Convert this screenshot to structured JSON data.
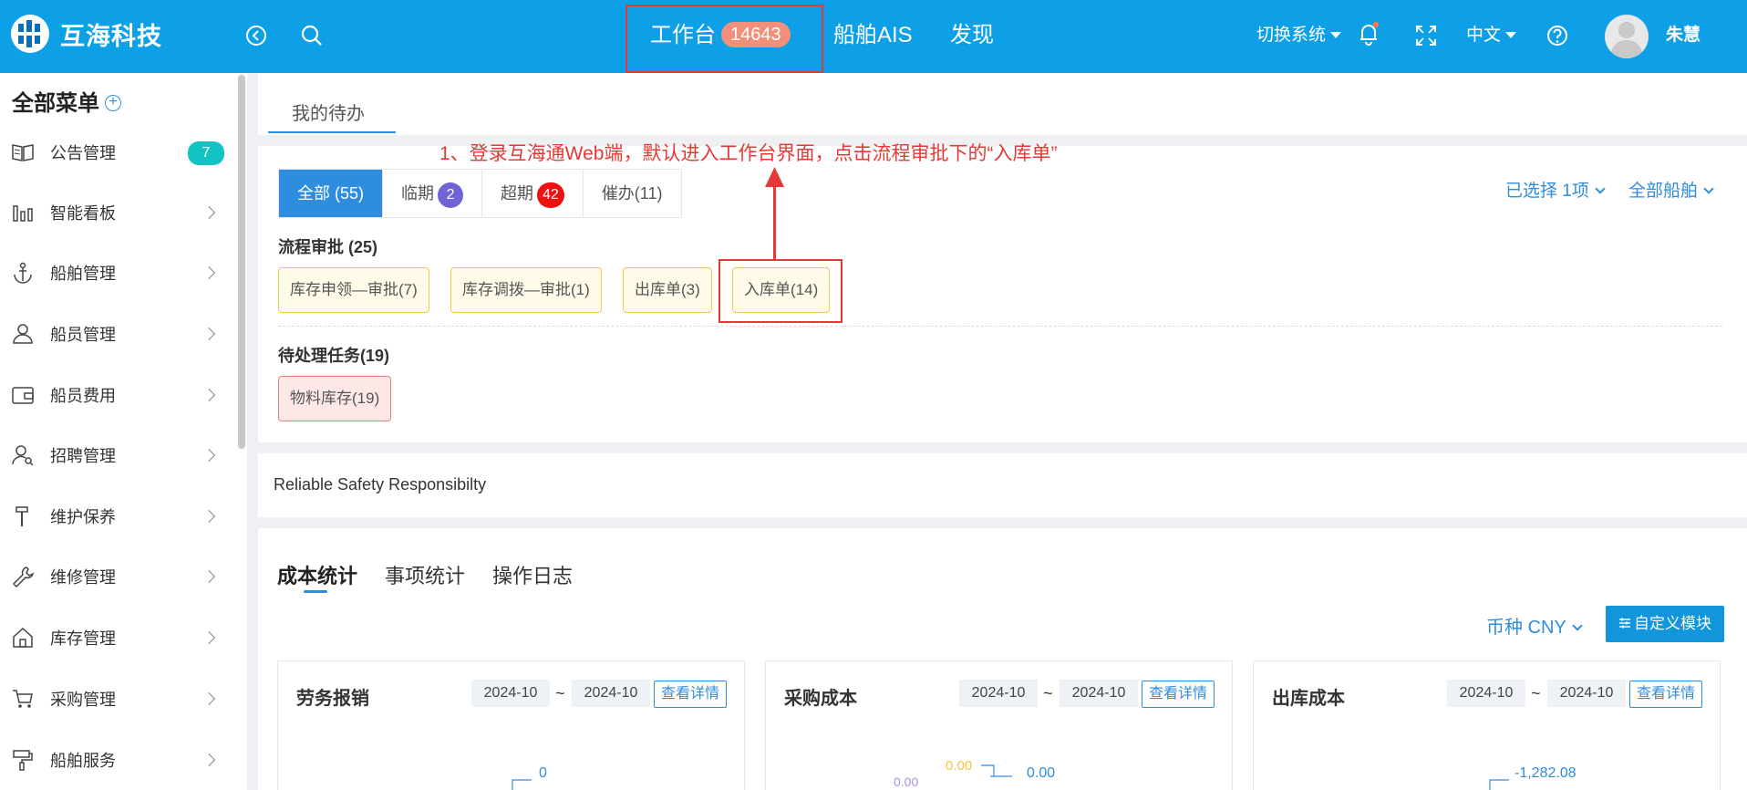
{
  "app": {
    "name": "互海科技"
  },
  "topnav": {
    "items": [
      {
        "label": "工作台",
        "badge": "14643"
      },
      {
        "label": "船舶AIS"
      },
      {
        "label": "发现"
      }
    ],
    "switch_system": "切换系统",
    "language": "中文",
    "username": "朱慧"
  },
  "sidebar": {
    "title": "全部菜单",
    "items": [
      {
        "label": "公告管理",
        "icon": "book-icon",
        "badge": "7"
      },
      {
        "label": "智能看板",
        "icon": "bar-chart-icon"
      },
      {
        "label": "船舶管理",
        "icon": "anchor-icon"
      },
      {
        "label": "船员管理",
        "icon": "user-icon"
      },
      {
        "label": "船员费用",
        "icon": "wallet-icon"
      },
      {
        "label": "招聘管理",
        "icon": "user-search-icon"
      },
      {
        "label": "维护保养",
        "icon": "hammer-icon"
      },
      {
        "label": "维修管理",
        "icon": "wrench-icon"
      },
      {
        "label": "库存管理",
        "icon": "home-icon"
      },
      {
        "label": "采购管理",
        "icon": "cart-icon"
      },
      {
        "label": "船舶服务",
        "icon": "paint-roller-icon"
      }
    ]
  },
  "todo": {
    "tab": "我的待办",
    "annotation": "1、登录互海通Web端，默认进入工作台界面，点击流程审批下的“入库单”",
    "filters": [
      {
        "label": "全部 (55)",
        "active": true
      },
      {
        "label": "临期",
        "badge": "2",
        "badge_color": "#6f63d6"
      },
      {
        "label": "超期",
        "badge": "42",
        "badge_color": "#ee1111"
      },
      {
        "label": "催办(11)"
      }
    ],
    "selected": "已选择 1项",
    "ships": "全部船舶",
    "section1_title": "流程审批 (25)",
    "section1_chips": [
      "库存申领—审批(7)",
      "库存调拨—审批(1)",
      "出库单(3)",
      "入库单(14)"
    ],
    "section2_title": "待处理任务(19)",
    "section2_chips": [
      "物料库存(19)"
    ]
  },
  "slogan": "Reliable Safety Responsibilty",
  "stats": {
    "tabs": [
      "成本统计",
      "事项统计",
      "操作日志"
    ],
    "currency": "币种 CNY",
    "custom_button": "自定义模块",
    "cards": [
      {
        "title": "劳务报销",
        "from": "2024-10",
        "to": "2024-10",
        "detail": "查看详情",
        "values": [
          "0"
        ]
      },
      {
        "title": "采购成本",
        "from": "2024-10",
        "to": "2024-10",
        "detail": "查看详情",
        "values": [
          "0.00",
          "0.00",
          "0.00"
        ]
      },
      {
        "title": "出库成本",
        "from": "2024-10",
        "to": "2024-10",
        "detail": "查看详情",
        "values": [
          "-1,282.08"
        ]
      }
    ]
  }
}
